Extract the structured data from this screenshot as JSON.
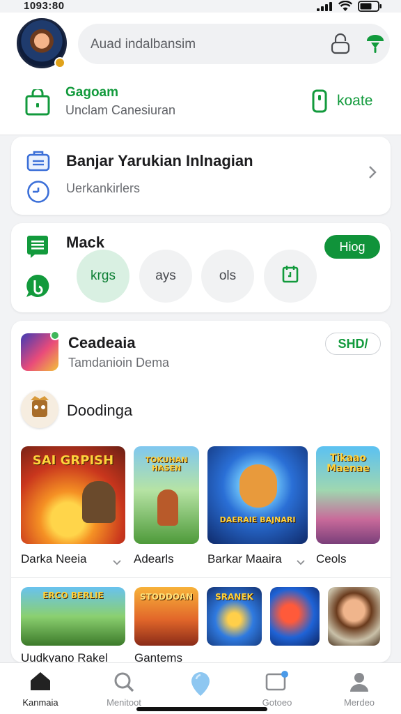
{
  "status_bar": {
    "time": "1093:80"
  },
  "header": {
    "search_text": "Auad indalbansim",
    "profile_title": "Gagoam",
    "profile_subtitle": "Unclam Canesiuran",
    "contact_label": "koate"
  },
  "card1": {
    "title": "Banjar Yarukian Inlnagian",
    "subtitle": "Uerkankirlers"
  },
  "card2": {
    "title": "Mack",
    "button_label": "Hiog",
    "chips": [
      {
        "label": "krgs",
        "active": true
      },
      {
        "label": "ays",
        "active": false
      },
      {
        "label": "ols",
        "active": false
      },
      {
        "label": "",
        "icon": "calendar-icon",
        "active": false
      }
    ]
  },
  "card3": {
    "title": "Ceadeaia",
    "subtitle": "Tamdanioin Dema",
    "tag_label": "SHD/",
    "section_title": "Doodinga",
    "games_row1": [
      {
        "caption": "SAI GRPISH",
        "label": "Darka Neeia",
        "has_chevron": true
      },
      {
        "caption": "TOKUHAN HASEN",
        "label": "Adearls",
        "has_chevron": false
      },
      {
        "caption": "DAERAIE BAJNARI",
        "label": "Barkar Maaira",
        "has_chevron": true
      },
      {
        "caption": "Tikaao Maenae",
        "label": "Ceols",
        "has_chevron": false
      }
    ],
    "games_row2": [
      {
        "caption": "ERCO BERLIE",
        "label": "Uudkyano Rakel"
      },
      {
        "caption": "STODDOAN",
        "label": "Gantems"
      },
      {
        "caption": "SRANEK",
        "label": ""
      },
      {
        "caption": "",
        "label": ""
      },
      {
        "caption": "",
        "label": ""
      }
    ]
  },
  "bottom_nav": [
    {
      "label": "Kanmaia",
      "icon": "home-icon",
      "active": true
    },
    {
      "label": "Menitoot",
      "icon": "search-icon",
      "active": false
    },
    {
      "label": "",
      "icon": "pin-icon",
      "active": false
    },
    {
      "label": "Gotoeo",
      "icon": "message-icon",
      "active": false
    },
    {
      "label": "Merdeo",
      "icon": "user-icon",
      "active": false
    }
  ],
  "colors": {
    "accent": "#129a3c",
    "accent_dark": "#10933a",
    "chip_active": "#d9f0e2"
  }
}
